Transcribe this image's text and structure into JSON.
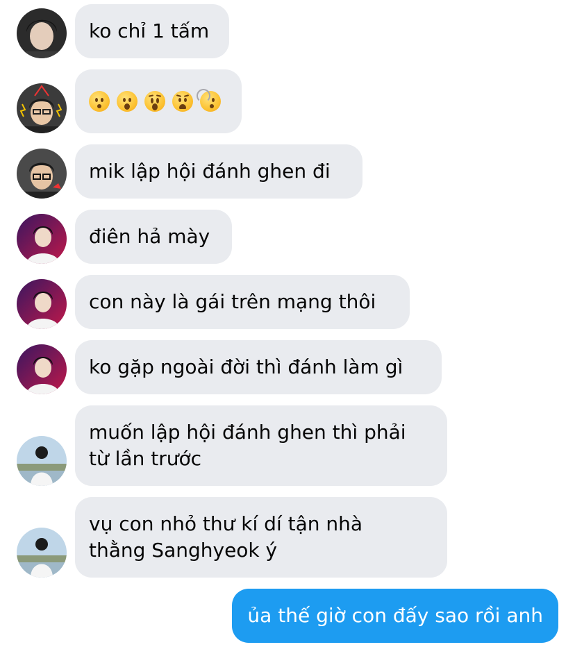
{
  "messages": [
    {
      "text": "ko chỉ 1 tấm"
    },
    {
      "emojis": [
        "hushed-face-emoji",
        "open-mouth-face-emoji",
        "astonished-face-emoji",
        "anguished-face-emoji",
        "dizzy-face-emoji"
      ]
    },
    {
      "text": "mik lập hội đánh ghen đi"
    },
    {
      "text": "điên hả mày"
    },
    {
      "text": "con này là gái trên mạng thôi"
    },
    {
      "text": "ko gặp ngoài đời thì đánh làm gì"
    },
    {
      "lines": [
        "muốn lập hội đánh ghen thì phải",
        "từ lần trước"
      ]
    },
    {
      "lines": [
        "vụ con nhỏ thư kí dí tận nhà",
        "thằng Sanghyeok ý"
      ]
    }
  ],
  "sent_message": {
    "text": "ủa thế giờ con đấy sao rồi anh"
  },
  "colors": {
    "received_bubble": "#e9ebef",
    "sent_bubble": "#1d9cf1",
    "text": "#050505"
  }
}
